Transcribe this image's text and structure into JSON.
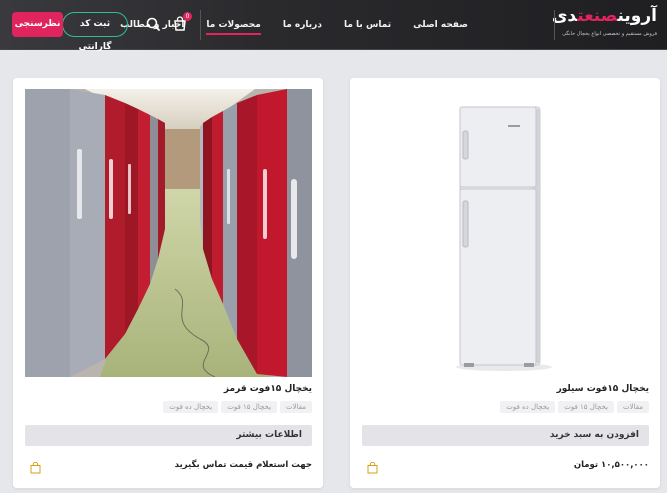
{
  "header": {
    "logo_main": "آروین",
    "logo_accent": "صنعت",
    "logo_tail": "دی",
    "logo_sub": "فروش مستقیم و تخصصی انواع یخچال خانگی و صنعتی",
    "nav": [
      {
        "label": "صفحه اصلی",
        "active": false
      },
      {
        "label": "تماس با ما",
        "active": false
      },
      {
        "label": "درباره ما",
        "active": false
      },
      {
        "label": "محصولات ما",
        "active": true
      },
      {
        "label": "اخبار و مطالب",
        "active": false
      }
    ],
    "cart_count": "0",
    "guarantee_label": "ثبت کد گارانتی",
    "survey_label": "نظرسنجی"
  },
  "products": [
    {
      "title": "یخچال ۱۵فوت سیلور",
      "tags": [
        "مقالات",
        "یخچال ۱۵ فوت",
        "یخچال ده فوت"
      ],
      "button_label": "افزودن به سبد خرید",
      "price": "۱۰,۵۰۰,۰۰۰ تومان"
    },
    {
      "title": "یخچال ۱۵فوت قرمز",
      "tags": [
        "مقالات",
        "یخچال ۱۵ فوت",
        "یخچال ده فوت"
      ],
      "button_label": "اطلاعات بیشتر",
      "price": "جهت استعلام قیمت تماس بگیرید"
    }
  ],
  "colors": {
    "accent": "#e0245e",
    "guarantee_border": "#2bbf9a",
    "header_bg": "#2a2a2d"
  }
}
